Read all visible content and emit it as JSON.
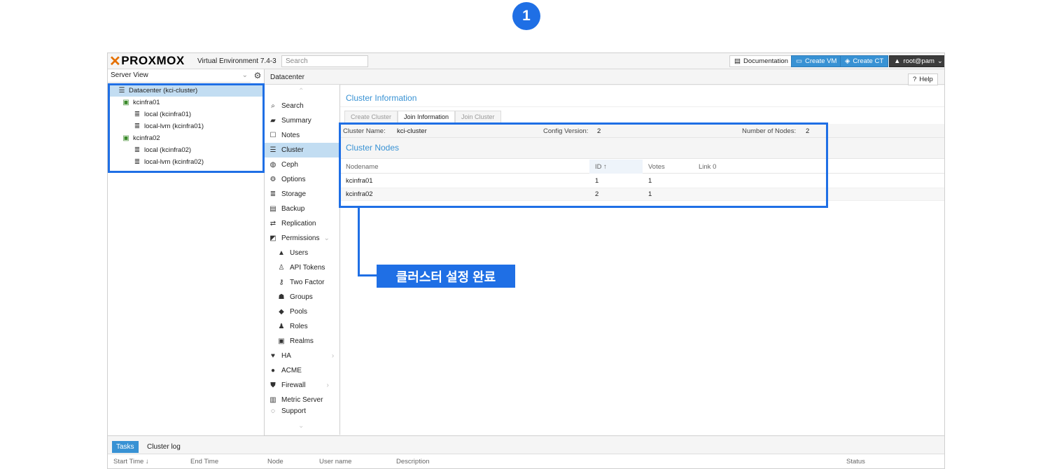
{
  "annotations": {
    "step_number": "1",
    "callout": "클러스터 설정 완료",
    "highlight_color": "#1f6fe5"
  },
  "topbar": {
    "logo_text": "PROXMOX",
    "version": "Virtual Environment 7.4-3",
    "search_placeholder": "Search",
    "documentation": "Documentation",
    "create_vm": "Create VM",
    "create_ct": "Create CT",
    "user": "root@pam"
  },
  "tree": {
    "view": "Server View",
    "items": [
      {
        "label": "Datacenter (kci-cluster)",
        "icon": "datacenter-icon"
      },
      {
        "label": "kcinfra01",
        "icon": "node-icon"
      },
      {
        "label": "local (kcinfra01)",
        "icon": "storage-icon"
      },
      {
        "label": "local-lvm (kcinfra01)",
        "icon": "storage-icon"
      },
      {
        "label": "kcinfra02",
        "icon": "node-icon"
      },
      {
        "label": "local (kcinfra02)",
        "icon": "storage-icon"
      },
      {
        "label": "local-lvm (kcinfra02)",
        "icon": "storage-icon"
      }
    ]
  },
  "breadcrumb": "Datacenter",
  "help": "Help",
  "nav": [
    {
      "label": "Search",
      "icon": "search-icon"
    },
    {
      "label": "Summary",
      "icon": "book-icon"
    },
    {
      "label": "Notes",
      "icon": "notes-icon"
    },
    {
      "label": "Cluster",
      "icon": "cluster-icon"
    },
    {
      "label": "Ceph",
      "icon": "ceph-icon"
    },
    {
      "label": "Options",
      "icon": "gear-icon"
    },
    {
      "label": "Storage",
      "icon": "database-icon"
    },
    {
      "label": "Backup",
      "icon": "floppy-icon"
    },
    {
      "label": "Replication",
      "icon": "retweet-icon"
    },
    {
      "label": "Permissions",
      "icon": "unlock-icon"
    },
    {
      "label": "Users",
      "icon": "user-icon"
    },
    {
      "label": "API Tokens",
      "icon": "token-icon"
    },
    {
      "label": "Two Factor",
      "icon": "key-icon"
    },
    {
      "label": "Groups",
      "icon": "users-icon"
    },
    {
      "label": "Pools",
      "icon": "tags-icon"
    },
    {
      "label": "Roles",
      "icon": "male-icon"
    },
    {
      "label": "Realms",
      "icon": "address-book-icon"
    },
    {
      "label": "HA",
      "icon": "heartbeat-icon"
    },
    {
      "label": "ACME",
      "icon": "certificate-icon"
    },
    {
      "label": "Firewall",
      "icon": "shield-icon"
    },
    {
      "label": "Metric Server",
      "icon": "bar-chart-icon"
    },
    {
      "label": "Support",
      "icon": "support-icon"
    }
  ],
  "cluster": {
    "info_title": "Cluster Information",
    "tabs": [
      "Create Cluster",
      "Join Information",
      "Join Cluster"
    ],
    "cluster_name_label": "Cluster Name:",
    "cluster_name": "kci-cluster",
    "config_version_label": "Config Version:",
    "config_version": "2",
    "num_nodes_label": "Number of Nodes:",
    "num_nodes": "2",
    "nodes_title": "Cluster Nodes",
    "columns": [
      "Nodename",
      "ID ↑",
      "Votes",
      "Link 0"
    ],
    "rows": [
      {
        "name": "kcinfra01",
        "id": "1",
        "votes": "1"
      },
      {
        "name": "kcinfra02",
        "id": "2",
        "votes": "1"
      }
    ]
  },
  "log": {
    "tabs": [
      "Tasks",
      "Cluster log"
    ],
    "columns": [
      "Start Time ↓",
      "End Time",
      "Node",
      "User name",
      "Description",
      "Status"
    ]
  }
}
